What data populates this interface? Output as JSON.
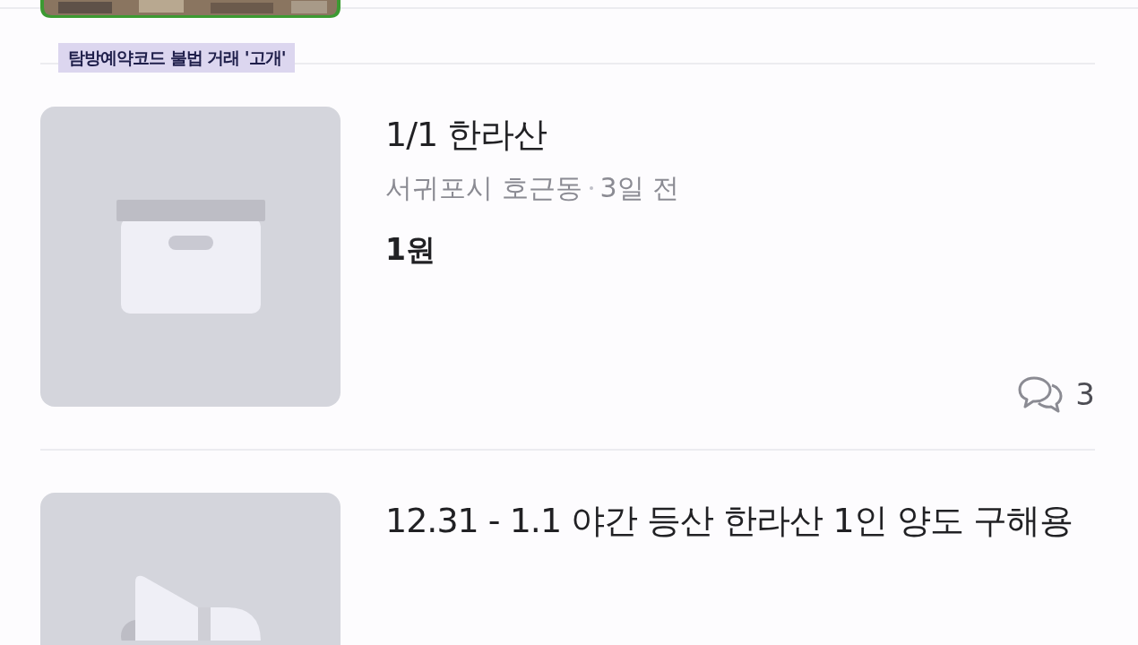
{
  "caption": "탐방예약코드 불법 거래 '고개'",
  "listings": [
    {
      "kind": "box",
      "title": "1/1 한라산",
      "location": "서귀포시 호근동",
      "time": "3일 전",
      "price": "1원",
      "comments": "3"
    },
    {
      "kind": "megaphone",
      "title": "12.31 - 1.1 야간 등산 한라산 1인 양도 구해용"
    }
  ]
}
